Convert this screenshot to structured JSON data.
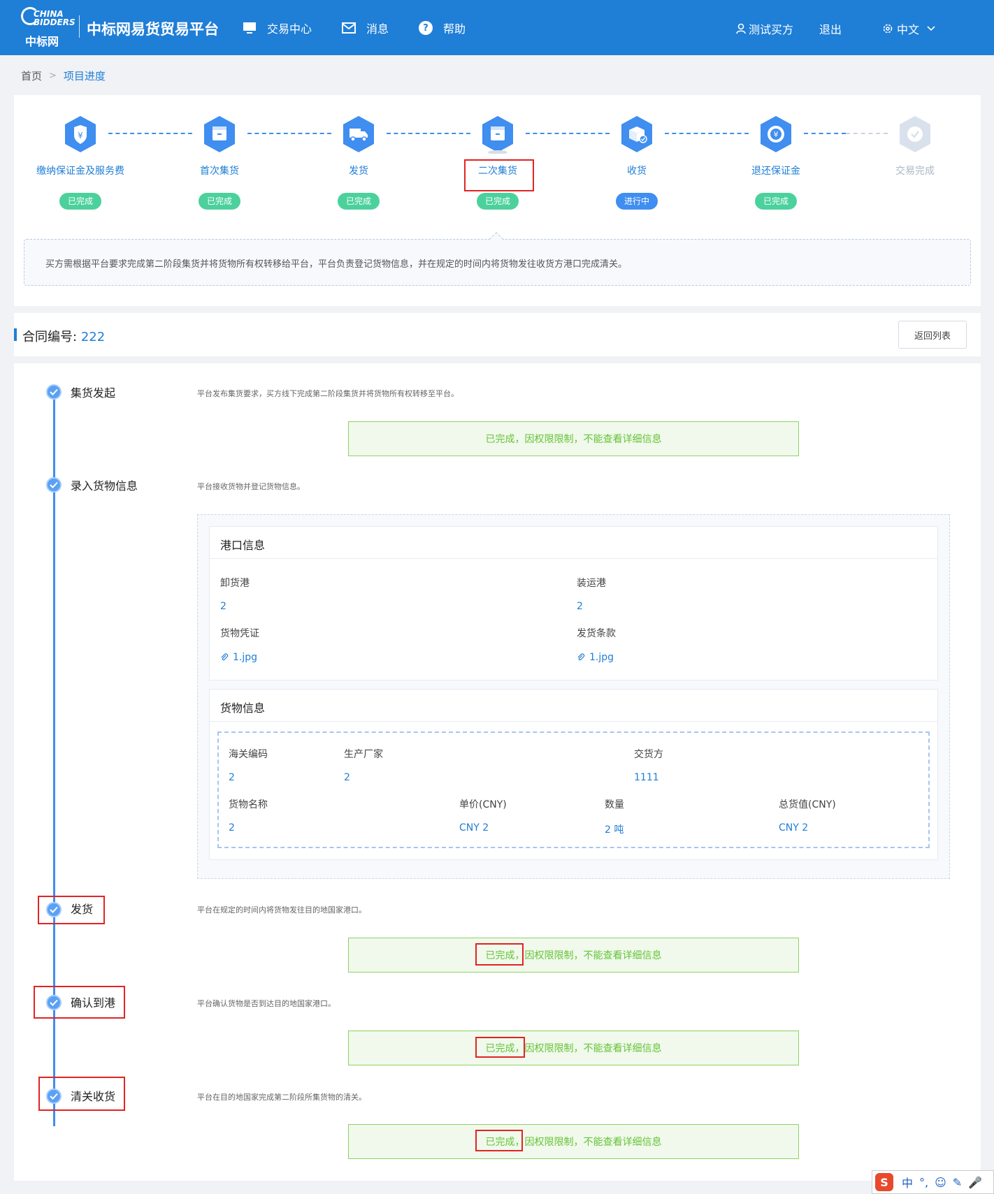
{
  "header": {
    "logo_top": "CHINA BIDDERS",
    "logo_bottom": "中标网",
    "site_title": "中标网易货贸易平台",
    "nav": [
      {
        "label": "交易中心",
        "icon": "monitor-icon"
      },
      {
        "label": "消息",
        "icon": "mail-icon"
      },
      {
        "label": "帮助",
        "icon": "help-icon"
      }
    ],
    "user": "测试买方",
    "logout": "退出",
    "language": "中文"
  },
  "breadcrumb": {
    "home": "首页",
    "current": "项目进度"
  },
  "steps": [
    {
      "label": "缴纳保证金及服务费",
      "status": "已完成",
      "icon": "shield-yen-icon"
    },
    {
      "label": "首次集货",
      "status": "已完成",
      "icon": "box-icon"
    },
    {
      "label": "发货",
      "status": "已完成",
      "icon": "truck-icon"
    },
    {
      "label": "二次集货",
      "status": "已完成",
      "icon": "box-icon"
    },
    {
      "label": "收货",
      "status": "进行中",
      "icon": "package-check-icon"
    },
    {
      "label": "退还保证金",
      "status": "已完成",
      "icon": "refund-icon"
    },
    {
      "label": "交易完成",
      "status": "",
      "icon": "check-circle-icon"
    }
  ],
  "step_description": "买方需根据平台要求完成第二阶段集货并将货物所有权转移给平台，平台负责登记货物信息，并在规定的时间内将货物发往收货方港口完成清关。",
  "contract": {
    "label": "合同编号:",
    "number": "222",
    "back_button": "返回列表"
  },
  "timeline": [
    {
      "title": "集货发起",
      "desc": "平台发布集货要求，买方线下完成第二阶段集货并将货物所有权转移至平台。",
      "notice": "已完成，因权限限制，不能查看详细信息"
    },
    {
      "title": "录入货物信息",
      "desc": "平台接收货物并登记货物信息。"
    },
    {
      "title": "发货",
      "desc": "平台在规定的时间内将货物发往目的地国家港口。",
      "notice": "已完成，因权限限制，不能查看详细信息"
    },
    {
      "title": "确认到港",
      "desc": "平台确认货物是否到达目的地国家港口。",
      "notice": "已完成，因权限限制，不能查看详细信息"
    },
    {
      "title": "清关收货",
      "desc": "平台在目的地国家完成第二阶段所集货物的清关。",
      "notice": "已完成，因权限限制，不能查看详细信息"
    }
  ],
  "port_info": {
    "title": "港口信息",
    "discharge_port_label": "卸货港",
    "discharge_port": "2",
    "loading_port_label": "装运港",
    "loading_port": "2",
    "goods_voucher_label": "货物凭证",
    "goods_voucher": "1.jpg",
    "shipping_terms_label": "发货条款",
    "shipping_terms": "1.jpg"
  },
  "goods_info": {
    "title": "货物信息",
    "hs_code_label": "海关编码",
    "hs_code": "2",
    "manufacturer_label": "生产厂家",
    "manufacturer": "2",
    "deliverer_label": "交货方",
    "deliverer": "1111",
    "name_label": "货物名称",
    "name": "2",
    "unit_price_label": "单价(CNY)",
    "unit_price": "CNY 2",
    "quantity_label": "数量",
    "quantity": "2 吨",
    "total_label": "总货值(CNY)",
    "total": "CNY 2"
  },
  "ime": {
    "logo": "S",
    "mode": "中",
    "punct": "°,"
  },
  "colors": {
    "primary": "#1f7ed6",
    "success": "#4cd19c",
    "active": "#3f8ef0",
    "highlight": "#e02424"
  }
}
